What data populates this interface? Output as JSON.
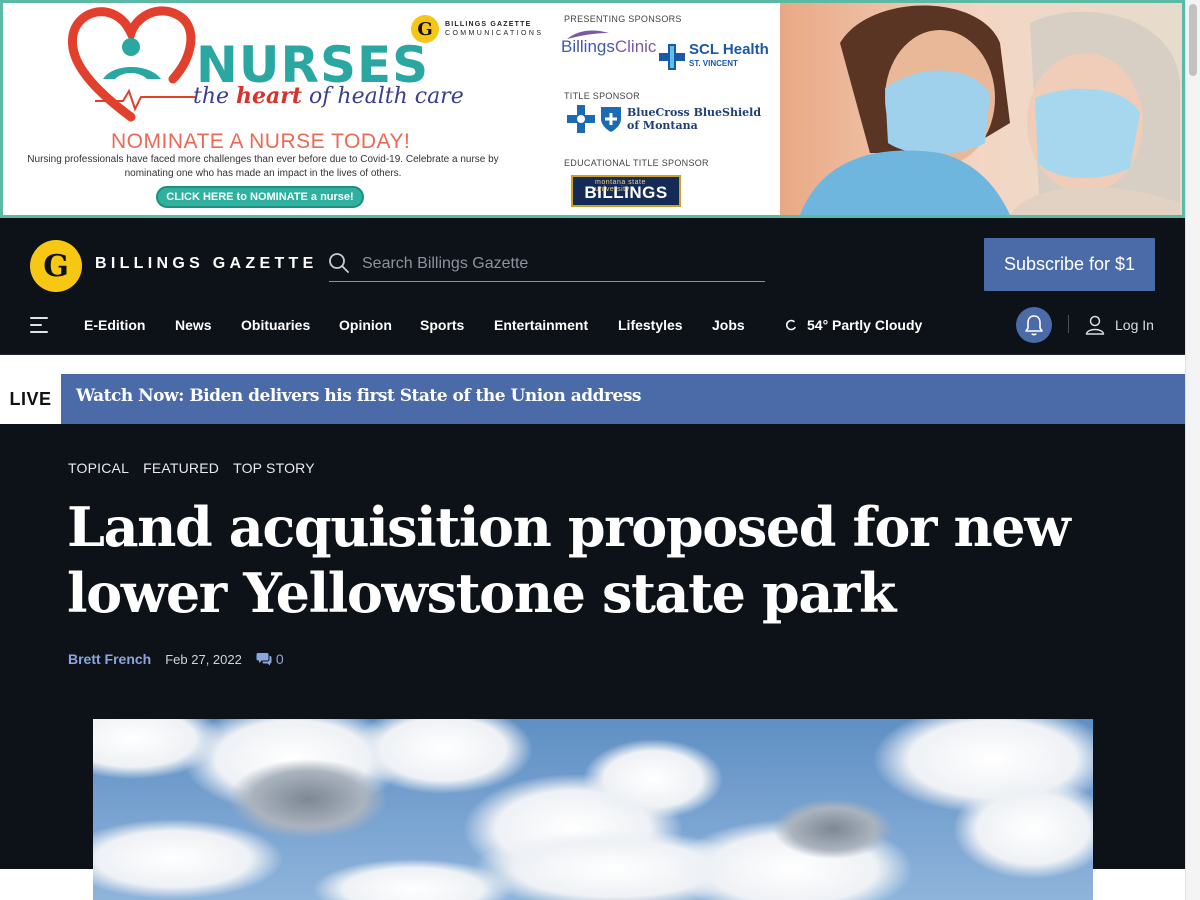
{
  "ad": {
    "nurses_word": "NURSES",
    "tagline_pre": "the ",
    "tagline_heart": "heart",
    "tagline_post": " of health care",
    "publisher_name": "BILLINGS GAZETTE",
    "publisher_sub": "COMMUNICATIONS",
    "nominate": "NOMINATE A NURSE TODAY!",
    "description": "Nursing professionals have faced more challenges than ever before due to Covid-19. Celebrate a nurse by nominating one who has made an impact in the lives of others.",
    "cta": "CLICK HERE to NOMINATE a nurse!",
    "presenting_label": "PRESENTING SPONSORS",
    "sponsor_billings_a": "Billings",
    "sponsor_billings_b": "Clinic",
    "sponsor_scl": "SCL Health",
    "sponsor_scl_sub": "ST. VINCENT",
    "title_label": "TITLE SPONSOR",
    "sponsor_bcbs_1": "BlueCross BlueShield",
    "sponsor_bcbs_2": "of Montana",
    "educational_label": "EDUCATIONAL TITLE SPONSOR",
    "sponsor_msu_small": "montana state university",
    "sponsor_msu": "BILLINGS",
    "accent_color": "#2aa7a0"
  },
  "header": {
    "logo_letter": "G",
    "brand": "BILLINGS GAZETTE",
    "search_placeholder": "Search Billings Gazette",
    "subscribe": "Subscribe for $1"
  },
  "nav": {
    "items": [
      "E-Edition",
      "News",
      "Obituaries",
      "Opinion",
      "Sports",
      "Entertainment",
      "Lifestyles",
      "Jobs"
    ],
    "weather": "54° Partly Cloudy",
    "login": "Log In"
  },
  "live": {
    "badge": "LIVE",
    "headline": "Watch Now: Biden delivers his first State of the Union address"
  },
  "article": {
    "tags": [
      "TOPICAL",
      "FEATURED",
      "TOP STORY"
    ],
    "headline": "Land acquisition proposed for new lower Yellowstone state park",
    "author": "Brett French",
    "date": "Feb 27, 2022",
    "comment_count": "0"
  },
  "colors": {
    "header_bg": "#0d1118",
    "brand_blue": "#4a6aa8",
    "logo_yellow": "#f6c814",
    "link_blue": "#8aa6dd"
  }
}
